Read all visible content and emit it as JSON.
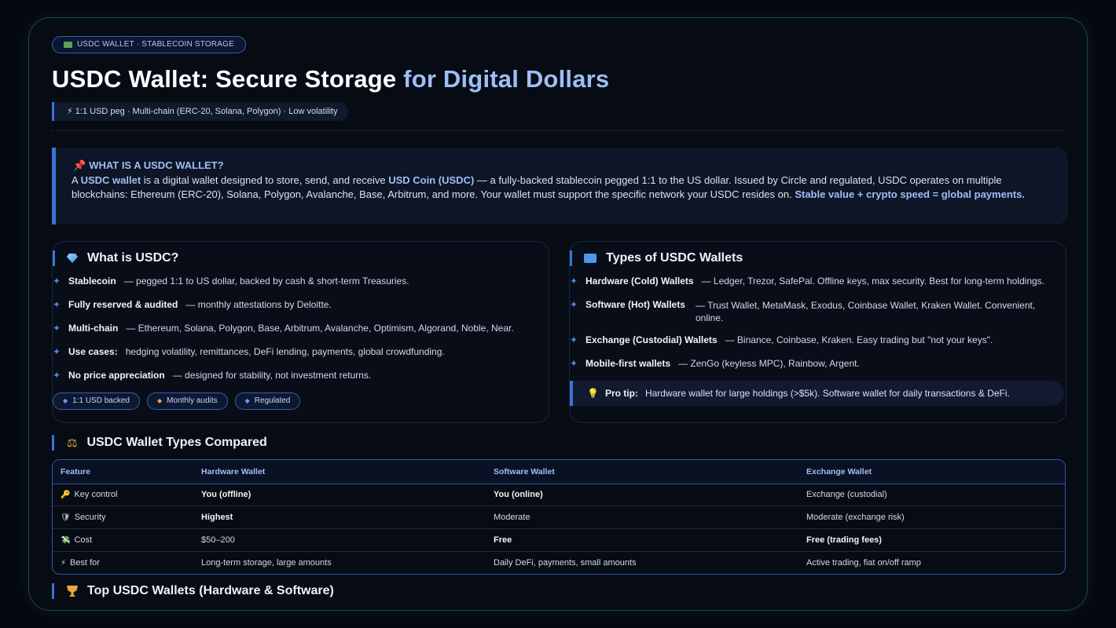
{
  "header": {
    "pill": "USDC WALLET · STABLECOIN STORAGE",
    "title_main": "USDC Wallet: Secure Storage ",
    "title_accent": "for Digital Dollars",
    "subtag": "⚡ 1:1 USD peg · Multi-chain (ERC-20, Solana, Polygon) · Low volatility"
  },
  "what_box": {
    "title": "WHAT IS A USDC WALLET?",
    "p1": "A ",
    "p1_hl": "USDC wallet",
    "p2": " is a digital wallet designed to store, send, and receive ",
    "p2_hl": "USD Coin (USDC)",
    "p3": " — a fully-backed stablecoin pegged 1:1 to the US dollar. Issued by Circle and regulated, USDC operates on multiple blockchains: Ethereum (ERC-20), Solana, Polygon, Avalanche, Base, Arbitrum, and more. Your wallet must support the specific network your USDC resides on. ",
    "p3_hl": "Stable value + crypto speed = global payments."
  },
  "what_is_usdc": {
    "title": "What is USDC?",
    "items": [
      {
        "label": "Stablecoin",
        "text": "— pegged 1:1 to US dollar, backed by cash & short-term Treasuries."
      },
      {
        "label": "Fully reserved & audited",
        "text": "— monthly attestations by Deloitte."
      },
      {
        "label": "Multi-chain",
        "text": "— Ethereum, Solana, Polygon, Base, Arbitrum, Avalanche, Optimism, Algorand, Noble, Near."
      },
      {
        "label": "Use cases:",
        "text": "hedging volatility, remittances, DeFi lending, payments, global crowdfunding."
      },
      {
        "label": "No price appreciation",
        "text": "— designed for stability, not investment returns."
      }
    ],
    "badges": [
      "1:1 USD backed",
      "Monthly audits",
      "Regulated"
    ]
  },
  "types": {
    "title": "Types of USDC Wallets",
    "items": [
      {
        "label": "Hardware (Cold) Wallets",
        "text": "— Ledger, Trezor, SafePal. Offline keys, max security. Best for long-term holdings."
      },
      {
        "label": "Software (Hot) Wallets",
        "text": "— Trust Wallet, MetaMask, Exodus, Coinbase Wallet, Kraken Wallet. Convenient, online."
      },
      {
        "label": "Exchange (Custodial) Wallets",
        "text": "— Binance, Coinbase, Kraken. Easy trading but \"not your keys\"."
      },
      {
        "label": "Mobile-first wallets",
        "text": "— ZenGo (keyless MPC), Rainbow, Argent."
      }
    ],
    "tip_label": "Pro tip:",
    "tip_text": "Hardware wallet for large holdings (>$5k). Software wallet for daily transactions & DeFi."
  },
  "compare": {
    "title": "USDC Wallet Types Compared",
    "headers": [
      "Feature",
      "Hardware Wallet",
      "Software Wallet",
      "Exchange Wallet"
    ],
    "rows": [
      [
        "🔑",
        "Key control",
        "You (offline)",
        "You (online)",
        "Exchange (custodial)"
      ],
      [
        "🛡",
        "Security",
        "Highest",
        "Moderate",
        "Moderate (exchange risk)"
      ],
      [
        "💸",
        "Cost",
        "$50–200",
        "Free",
        "Free (trading fees)"
      ],
      [
        "⚡",
        "Best for",
        "Long-term storage, large amounts",
        "Daily DeFi, payments, small amounts",
        "Active trading, fiat on/off ramp"
      ]
    ]
  },
  "top": {
    "title": "Top USDC Wallets (Hardware & Software)"
  }
}
